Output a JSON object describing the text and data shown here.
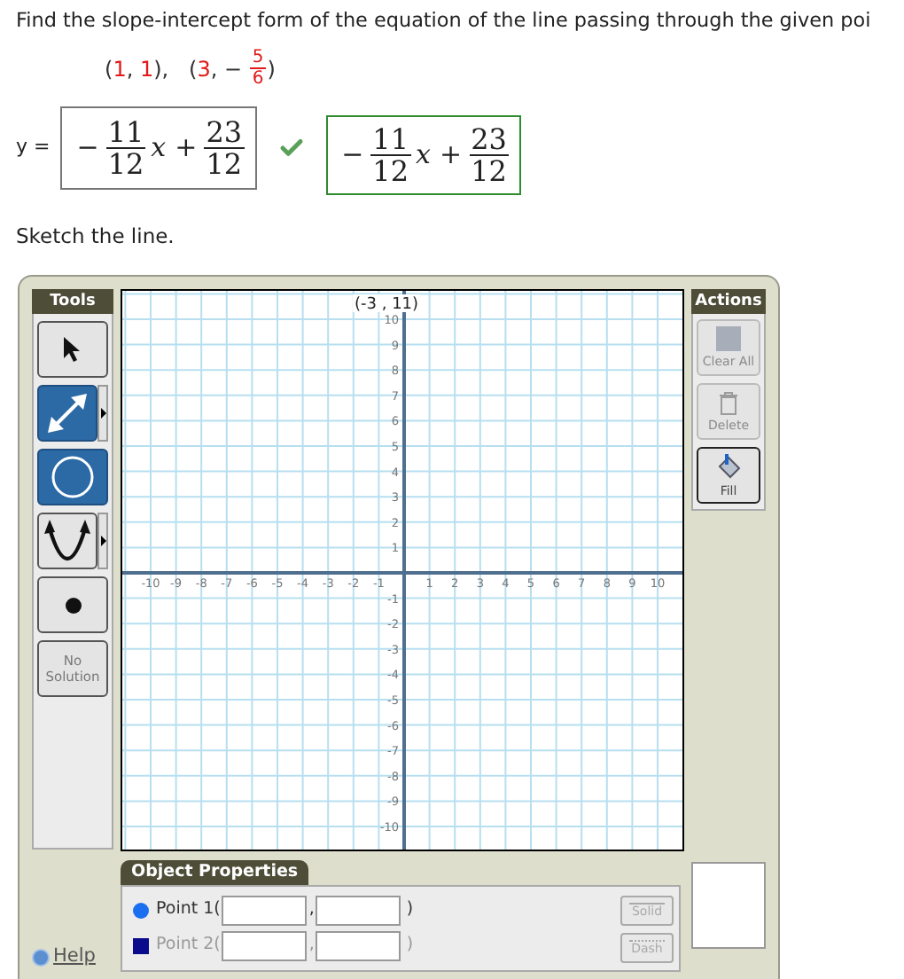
{
  "question": {
    "text": "Find the slope-intercept form of the equation of the line passing through the given poi",
    "points": [
      {
        "kind": "plain",
        "text": "("
      },
      {
        "kind": "red",
        "text": "1"
      },
      {
        "kind": "plain",
        "text": ", "
      },
      {
        "kind": "red",
        "text": "1"
      },
      {
        "kind": "plain",
        "text": "),   ("
      },
      {
        "kind": "red",
        "text": "3"
      },
      {
        "kind": "plain",
        "text": ", − "
      },
      {
        "kind": "redfrac",
        "num": "5",
        "den": "6"
      },
      {
        "kind": "plain",
        "text": ")"
      }
    ]
  },
  "answer": {
    "prefix": "y =",
    "correct": true,
    "terms": [
      {
        "kind": "op",
        "text": "−"
      },
      {
        "kind": "frac",
        "num": "11",
        "den": "12"
      },
      {
        "kind": "var",
        "text": "x"
      },
      {
        "kind": "op",
        "text": "+"
      },
      {
        "kind": "frac",
        "num": "23",
        "den": "12"
      }
    ],
    "correct_terms": [
      {
        "kind": "op",
        "text": "−"
      },
      {
        "kind": "frac",
        "num": "11",
        "den": "12"
      },
      {
        "kind": "var",
        "text": "x"
      },
      {
        "kind": "op",
        "text": "+"
      },
      {
        "kind": "frac",
        "num": "23",
        "den": "12"
      }
    ]
  },
  "sketch_label": "Sketch the line.",
  "tools": {
    "title": "Tools",
    "items": [
      {
        "kind": "select",
        "selected": false,
        "submenu": false
      },
      {
        "kind": "line",
        "selected": true,
        "submenu": true
      },
      {
        "kind": "circle",
        "selected": true,
        "submenu": false
      },
      {
        "kind": "parabola",
        "selected": false,
        "submenu": true
      },
      {
        "kind": "point",
        "selected": false,
        "submenu": false
      },
      {
        "kind": "text",
        "label": "No Solution",
        "selected": false,
        "submenu": false
      }
    ]
  },
  "graph": {
    "readout": "(-3 , 11)",
    "x_labels": [
      "-10",
      "-9",
      "-8",
      "-7",
      "-6",
      "-5",
      "-4",
      "-3",
      "-2",
      "-1",
      "1",
      "2",
      "3",
      "4",
      "5",
      "6",
      "7",
      "8",
      "9",
      "10"
    ],
    "y_labels": [
      "10",
      "9",
      "8",
      "7",
      "6",
      "5",
      "4",
      "3",
      "2",
      "1",
      "-1",
      "-2",
      "-3",
      "-4",
      "-5",
      "-6",
      "-7",
      "-8",
      "-9",
      "-10"
    ]
  },
  "actions": {
    "title": "Actions",
    "items": [
      {
        "kind": "clear",
        "label": "Clear All",
        "disabled": true
      },
      {
        "kind": "delete",
        "label": "Delete",
        "disabled": true
      },
      {
        "kind": "fill",
        "label": "Fill",
        "disabled": false
      }
    ]
  },
  "properties": {
    "title": "Object Properties",
    "rows": [
      {
        "kind": "circle",
        "color": "#1a6ff0",
        "label": "Point 1(",
        "separator": ",",
        "close": ")",
        "disabled": false
      },
      {
        "kind": "square",
        "color": "#0a0a8c",
        "label": "Point 2(",
        "separator": ",",
        "close": ")",
        "disabled": true
      }
    ],
    "styles": [
      {
        "kind": "solid",
        "label": "Solid",
        "disabled": true
      },
      {
        "kind": "dash",
        "label": "Dash",
        "disabled": true
      }
    ]
  },
  "help": "Help"
}
